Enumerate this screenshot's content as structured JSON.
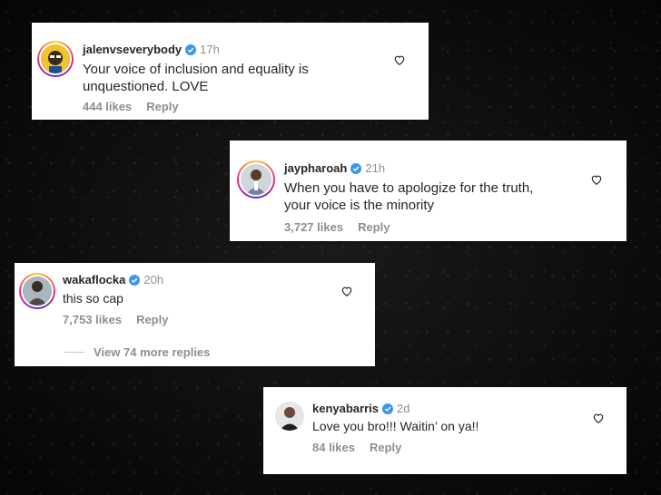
{
  "comments": [
    {
      "username": "jalenvseverybody",
      "time": "17h",
      "text_lines": [
        "Your voice of inclusion and equality is",
        "unquestioned. LOVE"
      ],
      "likes": "444 likes",
      "reply": "Reply"
    },
    {
      "username": "jaypharoah",
      "time": "21h",
      "text_lines": [
        "When you have to apologize for the truth,",
        "your voice is the minority"
      ],
      "likes": "3,727 likes",
      "reply": "Reply"
    },
    {
      "username": "wakaflocka",
      "time": "20h",
      "text_lines": [
        "this so cap"
      ],
      "likes": "7,753 likes",
      "reply": "Reply",
      "view_replies": "View 74 more replies"
    },
    {
      "username": "kenyabarris",
      "time": "2d",
      "text_lines": [
        "Love you bro!!! Waitin’ on ya!!"
      ],
      "likes": "84 likes",
      "reply": "Reply"
    }
  ],
  "colors": {
    "verified": "#3897f0",
    "muted": "#8e8e8e",
    "text": "#262626",
    "background": "#0b0b0b"
  },
  "icons": {
    "verified": "verified-badge-icon",
    "like": "heart-outline-icon"
  }
}
